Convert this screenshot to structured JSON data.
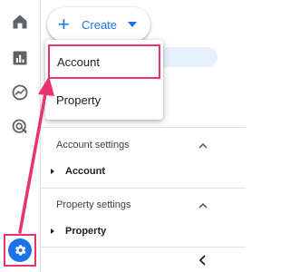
{
  "create_button": {
    "label": "Create"
  },
  "create_menu": {
    "items": [
      {
        "label": "Account"
      },
      {
        "label": "Property"
      }
    ]
  },
  "admin_sections": [
    {
      "title": "Account settings",
      "entry": "Account"
    },
    {
      "title": "Property settings",
      "entry": "Property"
    }
  ],
  "sidebar": {
    "icons": [
      "home-icon",
      "reports-icon",
      "explore-icon",
      "advertising-icon"
    ],
    "admin_icon": "gear-icon"
  },
  "colors": {
    "accent": "#1a73e8",
    "highlight": "#e8336f",
    "selected_pill": "#e8f0fe"
  }
}
